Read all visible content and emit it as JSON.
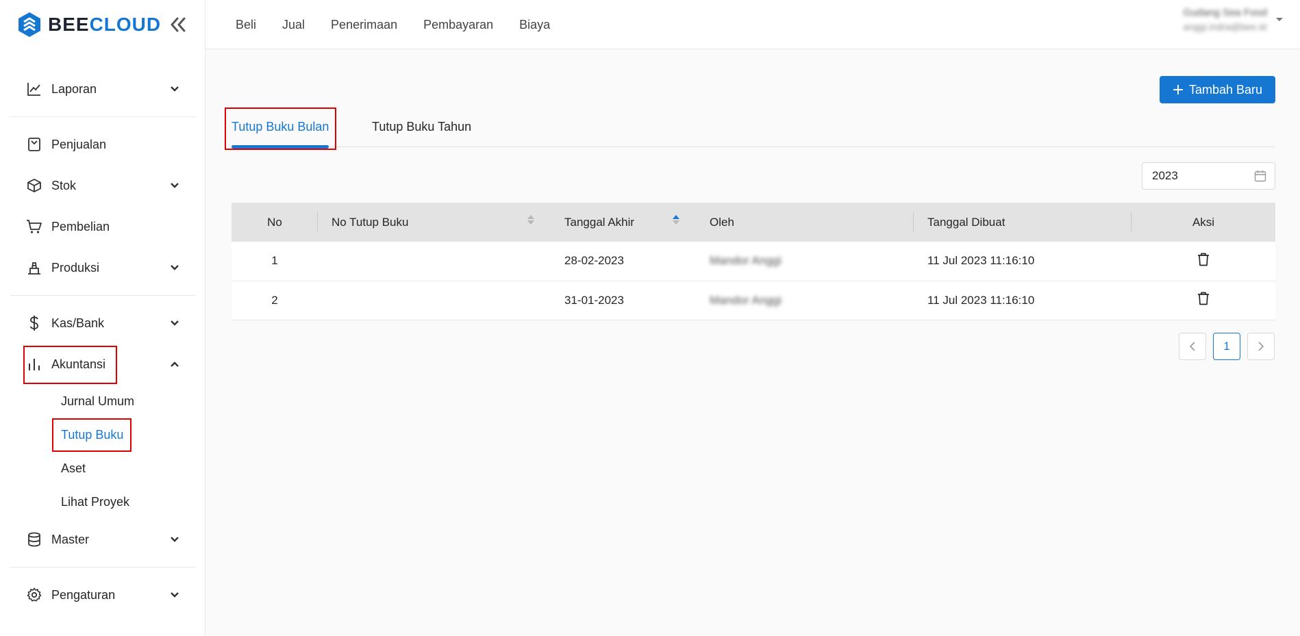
{
  "brand": {
    "bee": "BEE",
    "cloud": "CLOUD"
  },
  "topnav": [
    "Beli",
    "Jual",
    "Penerimaan",
    "Pembayaran",
    "Biaya"
  ],
  "user": {
    "name": "Gudang Sea Food",
    "email": "anggi.indra@bee.id"
  },
  "sidebar": {
    "items": [
      {
        "label": "Laporan",
        "icon": "line-chart-icon",
        "expandable": true
      },
      {
        "label": "Penjualan",
        "icon": "receipt-icon",
        "expandable": false
      },
      {
        "label": "Stok",
        "icon": "box-icon",
        "expandable": true
      },
      {
        "label": "Pembelian",
        "icon": "cart-icon",
        "expandable": true
      },
      {
        "label": "Produksi",
        "icon": "factory-icon",
        "expandable": true
      },
      {
        "label": "Kas/Bank",
        "icon": "dollar-icon",
        "expandable": true
      },
      {
        "label": "Akuntansi",
        "icon": "bar-chart-icon",
        "expandable": true,
        "expanded": true
      },
      {
        "label": "Master",
        "icon": "database-icon",
        "expandable": true
      },
      {
        "label": "Pengaturan",
        "icon": "gear-icon",
        "expandable": true
      }
    ],
    "akuntansi_sub": [
      "Jurnal Umum",
      "Tutup Buku",
      "Aset",
      "Lihat Proyek"
    ],
    "active_sub": "Tutup Buku"
  },
  "main": {
    "add_button": "Tambah Baru",
    "tabs": [
      "Tutup Buku Bulan",
      "Tutup Buku Tahun"
    ],
    "year": "2023",
    "table": {
      "headers": [
        "No",
        "No Tutup Buku",
        "Tanggal Akhir",
        "Oleh",
        "Tanggal Dibuat",
        "Aksi"
      ],
      "rows": [
        {
          "no": "1",
          "no_tutup_buku": "",
          "tanggal_akhir": "28-02-2023",
          "oleh": "Mandor Anggi",
          "tanggal_dibuat": "11 Jul 2023 11:16:10"
        },
        {
          "no": "2",
          "no_tutup_buku": "",
          "tanggal_akhir": "31-01-2023",
          "oleh": "Mandor Anggi",
          "tanggal_dibuat": "11 Jul 2023 11:16:10"
        }
      ]
    },
    "pagination": {
      "current": "1"
    }
  },
  "colors": {
    "primary": "#1677d2",
    "highlight": "#e00000"
  }
}
